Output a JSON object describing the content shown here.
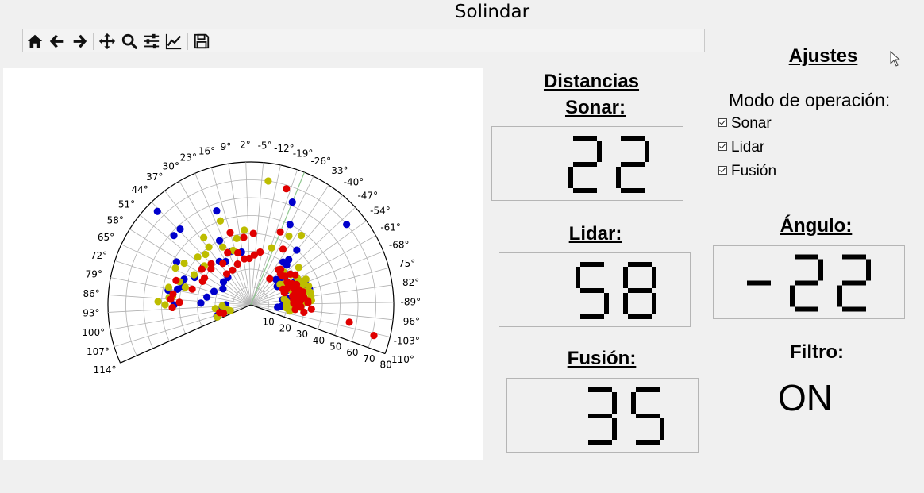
{
  "window": {
    "title": "Solindar"
  },
  "toolbar": {
    "buttons": [
      {
        "name": "home",
        "icon": "home-icon"
      },
      {
        "name": "back",
        "icon": "arrow-left-icon"
      },
      {
        "name": "forward",
        "icon": "arrow-right-icon"
      },
      {
        "name": "pan",
        "icon": "move-icon"
      },
      {
        "name": "zoom",
        "icon": "magnifier-icon"
      },
      {
        "name": "subplots",
        "icon": "sliders-icon"
      },
      {
        "name": "edit-axes",
        "icon": "line-chart-icon"
      },
      {
        "name": "save",
        "icon": "floppy-disk-icon"
      }
    ]
  },
  "readouts": {
    "distancias_label": "Distancias",
    "sonar_label": "Sonar:",
    "sonar_value": "22",
    "lidar_label": "Lidar:",
    "lidar_value": "58",
    "fusion_label": "Fusión:",
    "fusion_value": "35",
    "angulo_label": "Ángulo:",
    "angulo_value": "-22"
  },
  "settings": {
    "title": "Ajustes",
    "mode_label": "Modo de operación:",
    "options": [
      {
        "label": "Sonar",
        "checked": true
      },
      {
        "label": "Lidar",
        "checked": true
      },
      {
        "label": "Fusión",
        "checked": true
      }
    ],
    "filter_label": "Filtro:",
    "filter_value": "ON"
  },
  "chart_data": {
    "type": "scatter",
    "projection": "polar",
    "theta_range_deg": [
      -110,
      114
    ],
    "r_range": [
      0,
      80
    ],
    "theta_tick_labels": [
      "114°",
      "107°",
      "100°",
      "93°",
      "86°",
      "79°",
      "72°",
      "65°",
      "58°",
      "51°",
      "44°",
      "37°",
      "30°",
      "23°",
      "16°",
      "9°",
      "2°",
      "-5°",
      "-12°",
      "-19°",
      "-26°",
      "-33°",
      "-40°",
      "-47°",
      "-54°",
      "-61°",
      "-68°",
      "-75°",
      "-82°",
      "-89°",
      "-96°",
      "-103°",
      "-110°"
    ],
    "r_tick_labels": [
      "10",
      "20",
      "30",
      "40",
      "50",
      "60",
      "70",
      "80"
    ],
    "grid": true,
    "colors": {
      "sonar": "#0000cc",
      "lidar": "#bdbd00",
      "fusion": "#e00000",
      "guide_line": "#90c890"
    },
    "guide_line_theta_deg": -22,
    "series": [
      {
        "color_key": "sonar",
        "points": [
          [
            -22,
            62
          ],
          [
            -26,
            50
          ],
          [
            -37,
            30
          ],
          [
            -40,
            33
          ],
          [
            -47,
            26
          ],
          [
            -45,
            20
          ],
          [
            -55,
            18
          ],
          [
            -65,
            30
          ],
          [
            -68,
            22
          ],
          [
            -72,
            28
          ],
          [
            -75,
            25
          ],
          [
            -82,
            23
          ],
          [
            -85,
            23
          ],
          [
            -89,
            25
          ],
          [
            -70,
            33
          ],
          [
            -78,
            34
          ],
          [
            -62,
            30
          ],
          [
            -40,
            40
          ],
          [
            -50,
            70
          ],
          [
            -48,
            22
          ],
          [
            -60,
            20
          ],
          [
            -81,
            18
          ],
          [
            -93,
            17
          ],
          [
            -42,
            30
          ],
          [
            -75,
            34
          ],
          [
            -62,
            28
          ],
          [
            -88,
            30
          ],
          [
            -80,
            21
          ],
          [
            -67,
            25
          ],
          [
            -85,
            27
          ],
          [
            -57,
            24
          ],
          [
            -90,
            20
          ],
          [
            -95,
            15
          ],
          [
            -92,
            28
          ],
          [
            -78,
            20
          ],
          [
            -87,
            22
          ],
          [
            20,
            56
          ],
          [
            26,
            40
          ],
          [
            36,
            30
          ],
          [
            43,
            58
          ],
          [
            45,
            74
          ],
          [
            48,
            58
          ],
          [
            52,
            34
          ],
          [
            60,
            48
          ],
          [
            64,
            35
          ],
          [
            69,
            40
          ],
          [
            75,
            40
          ],
          [
            78,
            42
          ],
          [
            80,
            47
          ],
          [
            90,
            14
          ],
          [
            95,
            16
          ],
          [
            100,
            18
          ],
          [
            86,
            45
          ],
          [
            90,
            43
          ],
          [
            108,
            20
          ],
          [
            10,
            30
          ],
          [
            20,
            32
          ],
          [
            30,
            28
          ],
          [
            40,
            20
          ],
          [
            50,
            20
          ],
          [
            60,
            18
          ],
          [
            70,
            22
          ],
          [
            80,
            25
          ],
          [
            88,
            28
          ]
        ]
      },
      {
        "color_key": "lidar",
        "points": [
          [
            -20,
            34
          ],
          [
            -29,
            44
          ],
          [
            -36,
            48
          ],
          [
            -45,
            26
          ],
          [
            -53,
            28
          ],
          [
            -58,
            22
          ],
          [
            -65,
            34
          ],
          [
            -72,
            28
          ],
          [
            -76,
            32
          ],
          [
            -82,
            27
          ],
          [
            -88,
            30
          ],
          [
            -93,
            28
          ],
          [
            -62,
            30
          ],
          [
            -80,
            19
          ],
          [
            -85,
            25
          ],
          [
            -88,
            22
          ],
          [
            -66,
            26
          ],
          [
            -52,
            34
          ],
          [
            -70,
            24
          ],
          [
            -85,
            20
          ],
          [
            -78,
            24
          ],
          [
            -95,
            20
          ],
          [
            -99,
            22
          ],
          [
            -70,
            30
          ],
          [
            -86,
            34
          ],
          [
            -91,
            26
          ],
          [
            -96,
            24
          ],
          [
            -92,
            24
          ],
          [
            -82,
            34
          ],
          [
            -72,
            34
          ],
          [
            -80,
            30
          ],
          [
            -60,
            24
          ],
          [
            -55,
            20
          ],
          [
            -88,
            26
          ],
          [
            -78,
            34
          ],
          [
            -60,
            30
          ],
          [
            -68,
            32
          ],
          [
            -90,
            20
          ],
          [
            5,
            42
          ],
          [
            12,
            38
          ],
          [
            18,
            32
          ],
          [
            26,
            36
          ],
          [
            36,
            40
          ],
          [
            42,
            38
          ],
          [
            50,
            34
          ],
          [
            58,
            44
          ],
          [
            64,
            47
          ],
          [
            72,
            42
          ],
          [
            78,
            47
          ],
          [
            85,
            46
          ],
          [
            88,
            52
          ],
          [
            90,
            48
          ],
          [
            92,
            16
          ],
          [
            100,
            14
          ],
          [
            106,
            12
          ],
          [
            -8,
            70
          ],
          [
            20,
            50
          ],
          [
            35,
            46
          ],
          [
            48,
            40
          ],
          [
            62,
            36
          ],
          [
            75,
            38
          ],
          [
            84,
            44
          ],
          [
            92,
            44
          ],
          [
            96,
            20
          ],
          [
            103,
            13
          ],
          [
            110,
            20
          ]
        ]
      },
      {
        "color_key": "fusion",
        "points": [
          [
            -17,
            68
          ],
          [
            -22,
            44
          ],
          [
            -36,
            18
          ],
          [
            -38,
            25
          ],
          [
            -48,
            24
          ],
          [
            -52,
            28
          ],
          [
            -56,
            30
          ],
          [
            -64,
            20
          ],
          [
            -70,
            20
          ],
          [
            -78,
            24
          ],
          [
            -85,
            28
          ],
          [
            -92,
            28
          ],
          [
            -100,
            56
          ],
          [
            -104,
            71
          ],
          [
            -60,
            24
          ],
          [
            -66,
            22
          ],
          [
            -72,
            28
          ],
          [
            -76,
            30
          ],
          [
            -82,
            30
          ],
          [
            -88,
            32
          ],
          [
            -94,
            34
          ],
          [
            -98,
            30
          ],
          [
            -83,
            24
          ],
          [
            -79,
            25
          ],
          [
            -89,
            25
          ],
          [
            -96,
            25
          ],
          [
            -66,
            28
          ],
          [
            -74,
            26
          ],
          [
            -63,
            26
          ],
          [
            -58,
            24
          ],
          [
            -50,
            25
          ],
          [
            -44,
            24
          ],
          [
            -40,
            26
          ],
          [
            -84,
            27
          ],
          [
            -80,
            27
          ],
          [
            -86,
            32
          ],
          [
            -88,
            24
          ],
          [
            -76,
            27
          ],
          [
            -70,
            26
          ],
          [
            -64,
            24
          ],
          [
            -30,
            36
          ],
          [
            2,
            26
          ],
          [
            14,
            30
          ],
          [
            24,
            32
          ],
          [
            34,
            28
          ],
          [
            44,
            32
          ],
          [
            54,
            34
          ],
          [
            64,
            30
          ],
          [
            72,
            44
          ],
          [
            82,
            44
          ],
          [
            88,
            40
          ],
          [
            92,
            44
          ],
          [
            104,
            18
          ],
          [
            107,
            16
          ],
          [
            60,
            30
          ],
          [
            75,
            34
          ],
          [
            86,
            45
          ],
          [
            48,
            30
          ],
          [
            38,
            22
          ],
          [
            28,
            22
          ],
          [
            18,
            24
          ],
          [
            8,
            26
          ],
          [
            -4,
            28
          ],
          [
            -10,
            30
          ],
          [
            -2,
            40
          ],
          [
            6,
            38
          ],
          [
            16,
            42
          ]
        ]
      }
    ]
  }
}
